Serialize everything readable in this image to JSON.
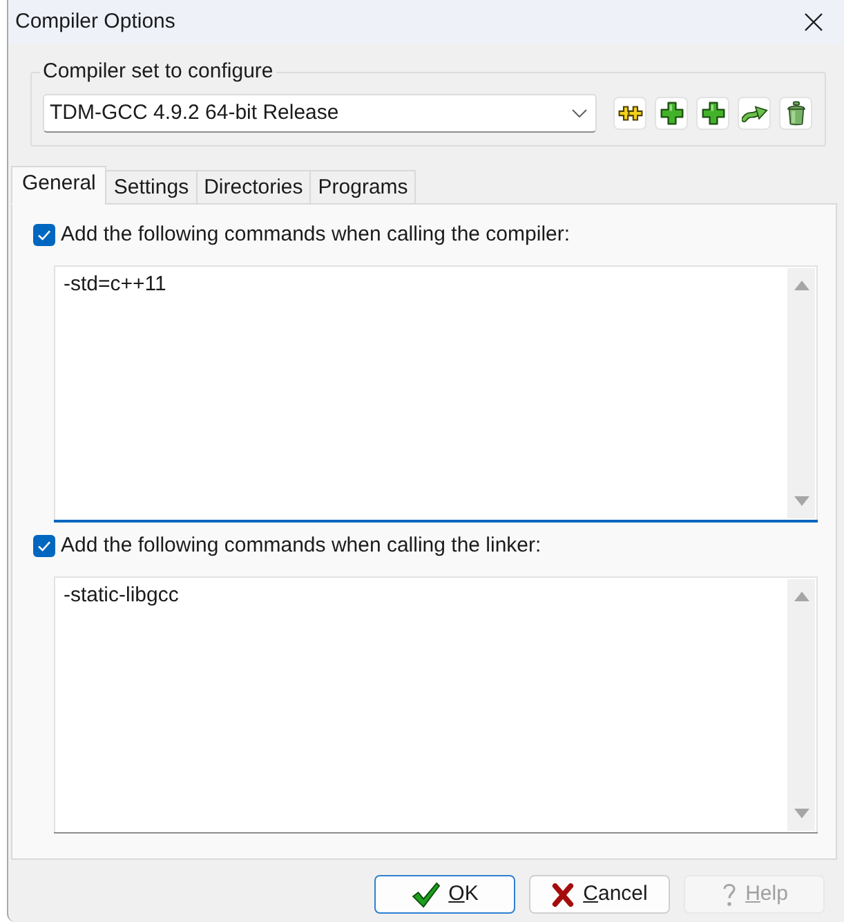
{
  "window": {
    "title": "Compiler Options"
  },
  "compiler_set": {
    "label": "Compiler set to configure",
    "value": "TDM-GCC 4.9.2 64-bit Release",
    "tool_buttons": [
      {
        "kind": "double_plus"
      },
      {
        "kind": "plus"
      },
      {
        "kind": "plus"
      },
      {
        "kind": "arrow"
      },
      {
        "kind": "trash"
      }
    ]
  },
  "tabs": [
    {
      "label": "General",
      "selected": true
    },
    {
      "label": "Settings",
      "selected": false
    },
    {
      "label": "Directories",
      "selected": false
    },
    {
      "label": "Programs",
      "selected": false
    }
  ],
  "general": {
    "sections": [
      {
        "label": "Add the following commands when calling the compiler:",
        "checked": true,
        "value": "-std=c++11",
        "focused": true
      },
      {
        "label": "Add the following commands when calling the linker:",
        "checked": true,
        "value": "-static-libgcc",
        "focused": false
      }
    ]
  },
  "buttons": [
    {
      "label": "OK",
      "kind": "ok",
      "default": true,
      "disabled": false
    },
    {
      "label": "Cancel",
      "kind": "cancel",
      "default": false,
      "disabled": false
    },
    {
      "label": "Help",
      "kind": "help",
      "default": false,
      "disabled": true
    }
  ]
}
